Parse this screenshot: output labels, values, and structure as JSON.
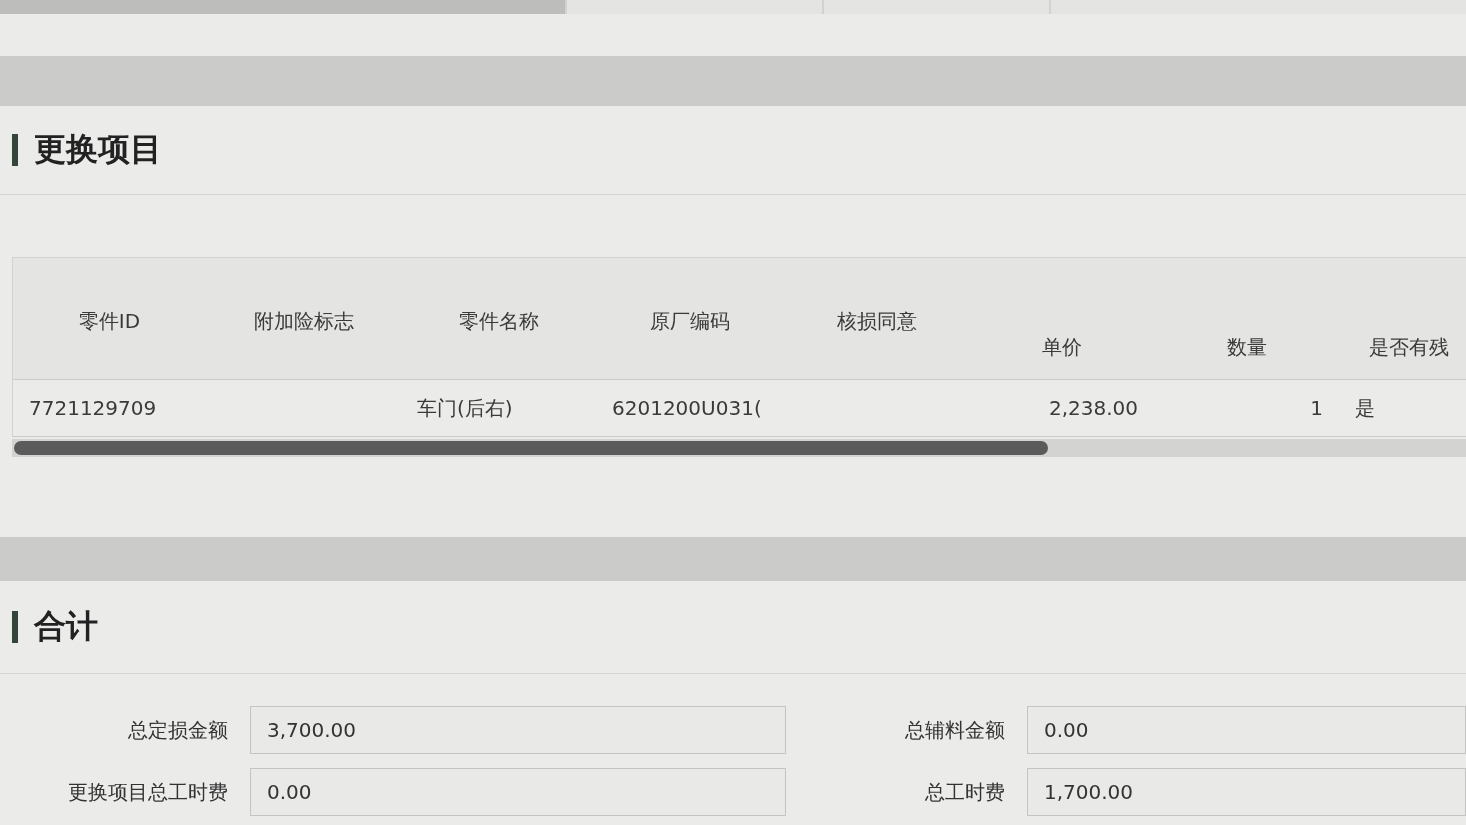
{
  "replace_items": {
    "title": "更换项目",
    "table": {
      "columns": [
        "零件ID",
        "附加险标志",
        "零件名称",
        "原厂编码",
        "核损同意",
        "单价",
        "数量",
        "是否有残"
      ],
      "rows": [
        {
          "part_id": "7721129709",
          "part_name": "车门(后右)",
          "oem_code": "6201200U031(",
          "unit_price": "2,238.00",
          "quantity": "1",
          "column_8": "是"
        }
      ]
    }
  },
  "totals": {
    "title": "合计",
    "fields": [
      {
        "label": "总定损金额",
        "value": "3,700.00"
      },
      {
        "label": "总辅料金额",
        "value": "0.00"
      },
      {
        "label": "更换项目总工时费",
        "value": "0.00"
      },
      {
        "label": "总工时费",
        "value": "1,700.00"
      }
    ]
  }
}
